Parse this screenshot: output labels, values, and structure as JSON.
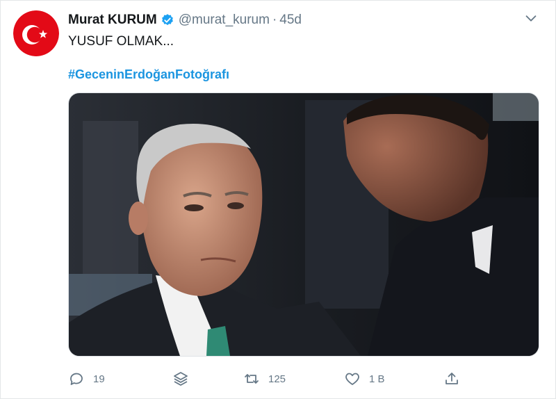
{
  "tweet": {
    "author_name": "Murat KURUM",
    "handle": "@murat_kurum",
    "separator": "·",
    "time": "45d",
    "text": "YUSUF OLMAK...",
    "hashtag": "#GeceninErdoğanFotoğrafı"
  },
  "actions": {
    "reply_count": "19",
    "retweet_count": "125",
    "like_count": "1 B"
  },
  "colors": {
    "accent": "#1b95e0",
    "verified": "#1da1f2",
    "muted": "#657786",
    "avatar_flag": "#e30a17"
  },
  "icons": {
    "verified": "verified-badge-icon",
    "caret": "chevron-down-icon",
    "reply": "reply-icon",
    "stack": "layers-icon",
    "retweet": "retweet-icon",
    "like": "heart-icon",
    "share": "share-icon"
  }
}
